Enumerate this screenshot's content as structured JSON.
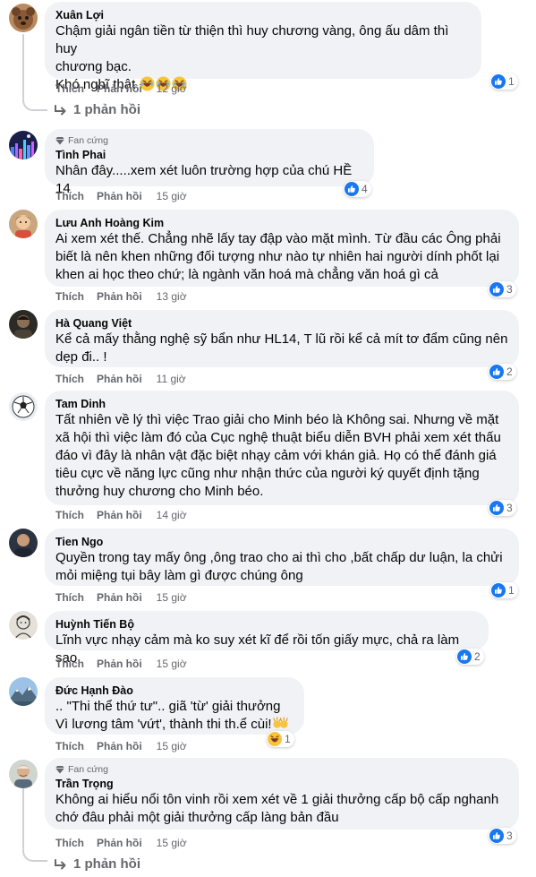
{
  "labels": {
    "like": "Thích",
    "reply": "Phản hồi",
    "fan_badge": "Fan cứng"
  },
  "colors": {
    "bubble": "#f0f2f5",
    "meta": "#65676b",
    "like_blue": "#1877f2",
    "badge_grey": "#65676b"
  },
  "comments": [
    {
      "author": "Xuân Lợi",
      "text": "Chậm giải ngân tiền từ thiện thì huy chương vàng, ông ấu dâm thì huy\nchương bạc.\nKhó nghĩ thật",
      "emoji_suffix": [
        "haha",
        "haha",
        "haha"
      ],
      "time": "12 giờ",
      "reactions": {
        "icons": [
          "like"
        ],
        "count": "1"
      },
      "replies_label": "1 phản hồi",
      "avatar": "dog-avatar"
    },
    {
      "author": "Tình Phai",
      "badge": true,
      "text": "Nhân đây.....xem xét luôn trường hợp của chú HỀ 14",
      "time": "15 giờ",
      "reactions": {
        "icons": [
          "like"
        ],
        "count": "4"
      },
      "avatar": "night-city-avatar"
    },
    {
      "author": "Lưu Anh Hoàng Kim",
      "text": "Ai xem xét thế. Chẳng nhẽ lấy tay đập vào mặt mình. Từ đầu các Ông phải\nbiết là nên khen những đối tượng như nào tự nhiên hai người dính phốt lại\nkhen ai học theo chứ; là ngành văn hoá mà chẳng văn hoá gì cả",
      "time": "13 giờ",
      "reactions": {
        "icons": [
          "like"
        ],
        "count": "3"
      },
      "avatar": "kid-avatar"
    },
    {
      "author": "Hà Quang Việt",
      "text": "Kể cả mấy thằng nghệ sỹ bẩn như HL14, T lũ rồi kể cả mít tơ đẩm cũng nên\ndẹp đi.. !",
      "time": "11 giờ",
      "reactions": {
        "icons": [
          "like"
        ],
        "count": "2"
      },
      "avatar": "dark-portrait-avatar"
    },
    {
      "author": "Tam Dinh",
      "text": "Tất nhiên về lý thì việc Trao giải cho Minh béo là Không sai. Nhưng về mặt\nxã hội thì việc làm đó của Cục nghệ thuật biểu diễn BVH phải xem xét thấu\nđáo vì đây là nhân vật đặc biệt nhạy cảm với khán giả. Họ có thể đánh giá\ntiêu cực về năng lực cũng như nhận thức của người ký quyết định tặng\nthưởng huy chương cho Minh béo.",
      "time": "14 giờ",
      "reactions": {
        "icons": [
          "like"
        ],
        "count": "3"
      },
      "avatar": "soccer-ball-avatar"
    },
    {
      "author": "Tien Ngo",
      "text": "Quyền trong tay mấy ông ,ông trao cho ai thì cho ,bất chấp dư luận, la chửi\nmỏi miệng tụi bây làm gì được chúng ông",
      "time": "15 giờ",
      "reactions": {
        "icons": [
          "like"
        ],
        "count": "1"
      },
      "avatar": "man-avatar"
    },
    {
      "author": "Huỳnh Tiến Bộ",
      "text": "Lĩnh vực nhạy cảm mà ko suy xét kĩ để rồi tốn giấy mực, chả ra làm sao",
      "time": "15 giờ",
      "reactions": {
        "icons": [
          "like"
        ],
        "count": "2"
      },
      "avatar": "sketch-avatar"
    },
    {
      "author": "Đức Hạnh Đào",
      "text": ".. \"Thi thể thứ tư\".. giã 'từ' giải thưởng\nVì lương tâm 'vứt', thành thi th.ể cùi!",
      "emoji_suffix": [
        "hands"
      ],
      "time": "15 giờ",
      "reactions": {
        "icons": [
          "haha"
        ],
        "count": "1"
      },
      "avatar": "mountain-avatar"
    },
    {
      "author": "Trần Trọng",
      "badge": true,
      "text": "Không ai hiểu nổi tôn vinh rồi xem xét về 1 giải thưởng cấp bộ cấp nghanh\nchớ đâu phải một giải thưởng cấp làng bản đầu",
      "time": "15 giờ",
      "reactions": {
        "icons": [
          "like"
        ],
        "count": "3"
      },
      "replies_label": "1 phản hồi",
      "avatar": "old-man-avatar"
    }
  ]
}
